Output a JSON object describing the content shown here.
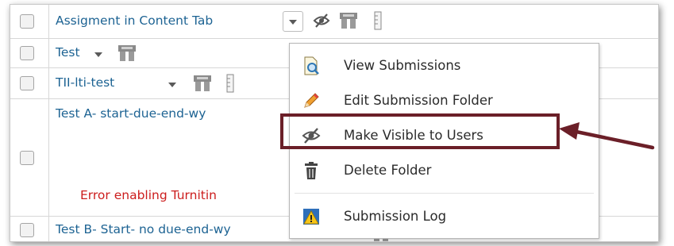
{
  "rows": [
    {
      "title": "Assigment in Content Tab"
    },
    {
      "title": "Test"
    },
    {
      "title": "TII-lti-test"
    },
    {
      "title": "Test A- start-due-end-wy",
      "error": "Error enabling Turnitin"
    },
    {
      "title": "Test B- Start- no due-end-wy"
    }
  ],
  "menu": {
    "items": [
      {
        "label": "View Submissions",
        "icon": "view-submissions-icon"
      },
      {
        "label": "Edit Submission Folder",
        "icon": "pencil-icon"
      },
      {
        "label": "Make Visible to Users",
        "icon": "eye-slash-icon"
      },
      {
        "label": "Delete Folder",
        "icon": "trash-icon"
      },
      {
        "label": "Submission Log",
        "icon": "warning-icon"
      }
    ]
  },
  "colors": {
    "link": "#1d6393",
    "error": "#cc1d1d",
    "highlight": "#6b1f28"
  }
}
